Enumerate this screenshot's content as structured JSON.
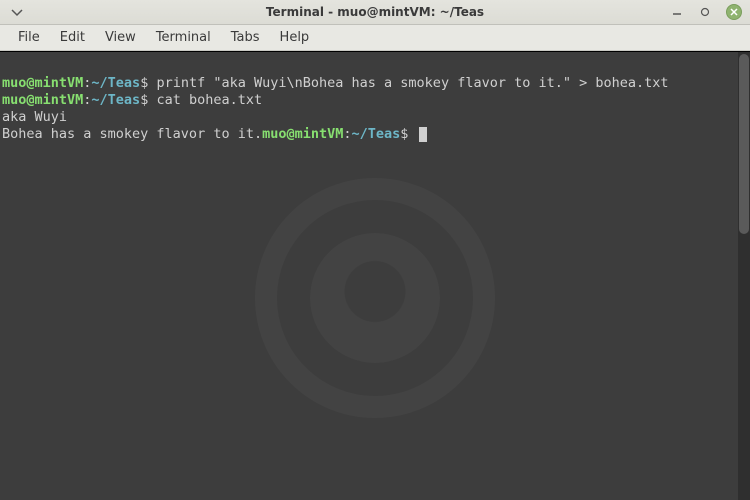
{
  "window": {
    "title": "Terminal - muo@mintVM: ~/Teas"
  },
  "menu": {
    "file": "File",
    "edit": "Edit",
    "view": "View",
    "terminal": "Terminal",
    "tabs": "Tabs",
    "help": "Help"
  },
  "prompt": {
    "user": "muo@mintVM",
    "colon": ":",
    "path": "~/Teas",
    "symbol": "$ "
  },
  "lines": {
    "cmd1": "printf \"aka Wuyi\\nBohea has a smokey flavor to it.\" > bohea.txt",
    "cmd2": "cat bohea.txt",
    "out1": "aka Wuyi",
    "out2": "Bohea has a smokey flavor to it."
  }
}
